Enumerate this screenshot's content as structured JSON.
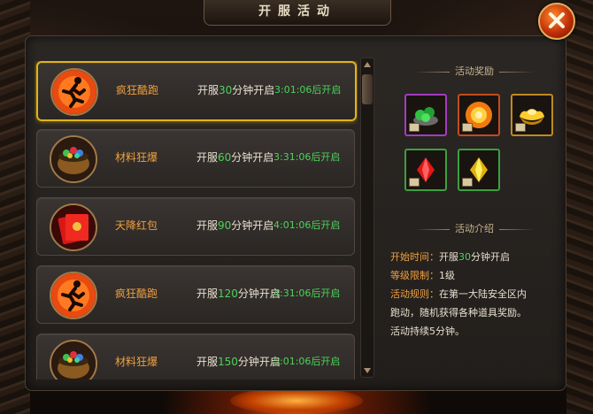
{
  "window": {
    "title": "开服活动",
    "close_icon": "close-icon"
  },
  "activities": [
    {
      "name": "疯狂酷跑",
      "time_prefix": "开服",
      "minutes": "30",
      "time_suffix": "分钟开启",
      "countdown": "3:01:06后开启",
      "icon": "running-man-icon",
      "selected": true
    },
    {
      "name": "材料狂爆",
      "time_prefix": "开服",
      "minutes": "60",
      "time_suffix": "分钟开启",
      "countdown": "3:31:06后开启",
      "icon": "treasure-pot-icon",
      "selected": false
    },
    {
      "name": "天降红包",
      "time_prefix": "开服",
      "minutes": "90",
      "time_suffix": "分钟开启",
      "countdown": "4:01:06后开启",
      "icon": "red-envelope-icon",
      "selected": false
    },
    {
      "name": "疯狂酷跑",
      "time_prefix": "开服",
      "minutes": "120",
      "time_suffix": "分钟开启",
      "countdown": "4:31:06后开启",
      "icon": "running-man-icon",
      "selected": false
    },
    {
      "name": "材料狂爆",
      "time_prefix": "开服",
      "minutes": "150",
      "time_suffix": "分钟开启",
      "countdown": "5:01:06后开启",
      "icon": "treasure-pot-icon",
      "selected": false
    }
  ],
  "rewards": {
    "heading": "活动奖励",
    "items": [
      {
        "icon": "green-gems-icon",
        "border": "#a23cc0"
      },
      {
        "icon": "gold-coin-orb-icon",
        "border": "#c04c20"
      },
      {
        "icon": "gold-ingot-icon",
        "border": "#c08a20"
      },
      {
        "icon": "red-crystal-icon",
        "border": "#3ca040"
      },
      {
        "icon": "yellow-crystal-icon",
        "border": "#3ca040"
      }
    ]
  },
  "intro": {
    "heading": "活动介绍",
    "start_label": "开始时间：",
    "start_prefix": "开服",
    "start_minutes": "30",
    "start_suffix": "分钟开启",
    "level_label": "等级限制：",
    "level_value": "1级",
    "rules_label": "活动规则：",
    "rules_line1": "在第一大陆安全区内",
    "rules_line2": "跑动，随机获得各种道具奖励。",
    "rules_line3": "活动持续5分钟。"
  },
  "colors": {
    "accent_orange": "#f0a040",
    "accent_green": "#4cd35a",
    "selected_border": "#e0b514"
  }
}
